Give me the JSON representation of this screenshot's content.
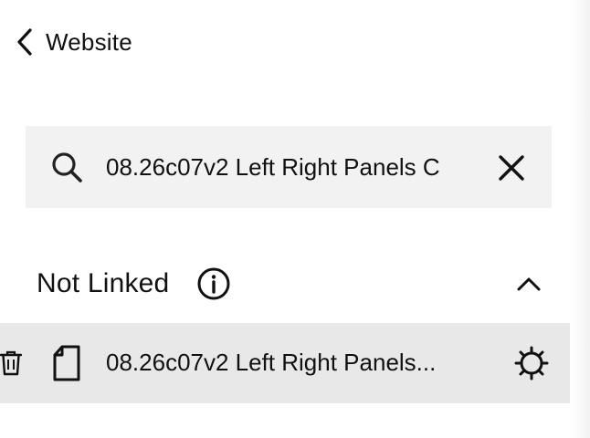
{
  "nav": {
    "back_label": "Website"
  },
  "search": {
    "value": "08.26c07v2 Left Right Panels C",
    "placeholder": "Search"
  },
  "section": {
    "title": "Not Linked",
    "collapsed": false
  },
  "pages": [
    {
      "title": "08.26c07v2 Left Right Panels..."
    }
  ],
  "icons": {
    "back": "chevron-left-icon",
    "search": "search-icon",
    "clear": "close-icon",
    "info": "info-icon",
    "collapse": "chevron-up-icon",
    "delete": "trash-icon",
    "page": "page-icon",
    "settings": "gear-icon"
  },
  "colors": {
    "text": "#111111",
    "search_bg": "#f2f2f2",
    "row_selected_bg": "#e8e8e8"
  }
}
